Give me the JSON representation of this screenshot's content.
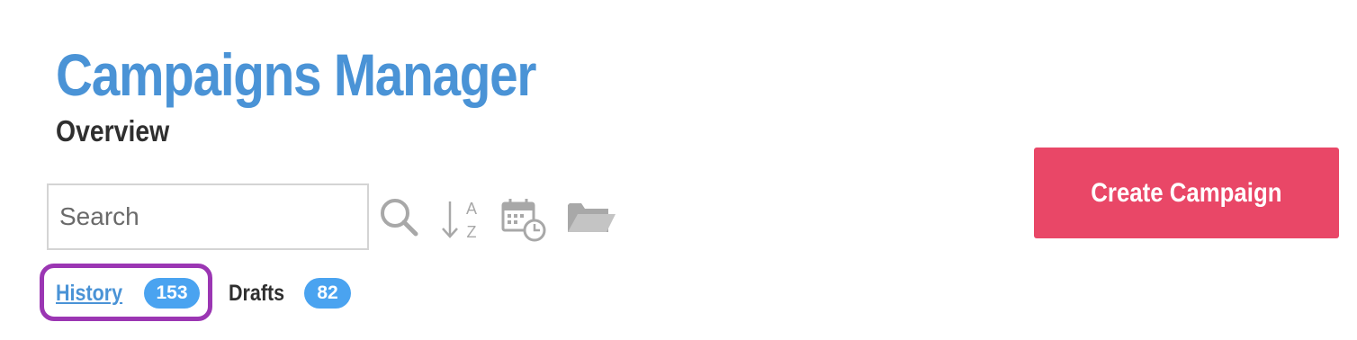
{
  "header": {
    "title": "Campaigns Manager",
    "subtitle": "Overview",
    "title_color": "#4a93d6"
  },
  "toolbar": {
    "search_placeholder": "Search",
    "search_value": "",
    "icons": [
      "search-icon",
      "sort-alpha-icon",
      "calendar-clock-icon",
      "folder-open-icon"
    ],
    "icon_color": "#a8a8a8"
  },
  "create_button": {
    "label": "Create Campaign",
    "color": "#e94767"
  },
  "tabs": [
    {
      "label": "History",
      "count": "153",
      "active": true
    },
    {
      "label": "Drafts",
      "count": "82",
      "active": false
    }
  ],
  "colors": {
    "badge": "#4aa3f0",
    "highlight": "#9b36b3",
    "active_tab": "#4a93d6"
  }
}
